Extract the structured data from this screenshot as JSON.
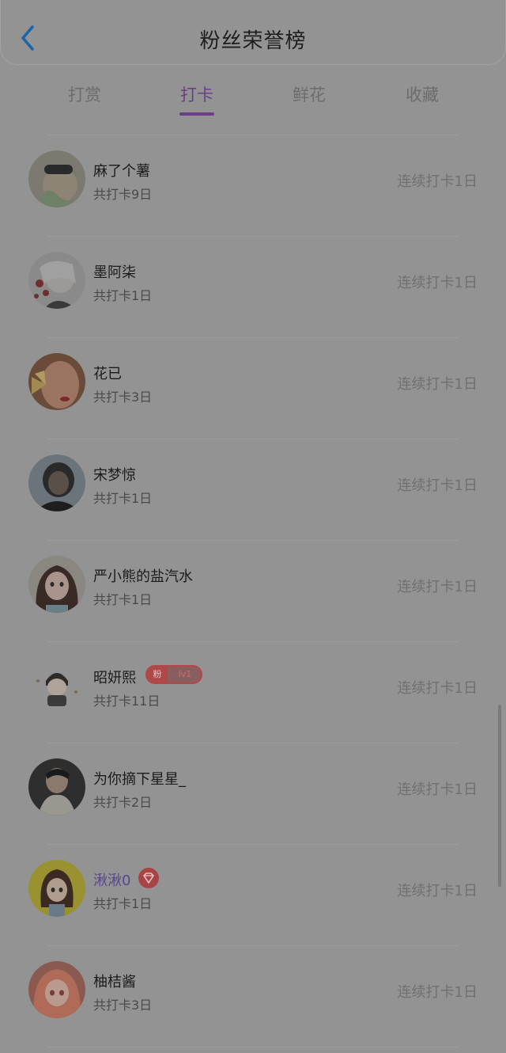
{
  "header": {
    "title": "粉丝荣誉榜",
    "back_icon": "chevron-left-icon",
    "back_color": "#1a66a8"
  },
  "tabs": [
    {
      "label": "打赏",
      "active": false
    },
    {
      "label": "打卡",
      "active": true
    },
    {
      "label": "鲜花",
      "active": false
    },
    {
      "label": "收藏",
      "active": false
    }
  ],
  "accent_color": "#6a3e86",
  "fans": [
    {
      "name": "麻了个薯",
      "total": "共打卡9日",
      "streak": "连续打卡1日",
      "avatar": "avatar-sunglasses-girl"
    },
    {
      "name": "墨阿柒",
      "total": "共打卡1日",
      "streak": "连续打卡1日",
      "avatar": "avatar-anime-girl-roses"
    },
    {
      "name": "花已",
      "total": "共打卡3日",
      "streak": "连续打卡1日",
      "avatar": "avatar-girl-butterfly"
    },
    {
      "name": "宋梦惊",
      "total": "共打卡1日",
      "streak": "连续打卡1日",
      "avatar": "avatar-dark-portrait"
    },
    {
      "name": "严小熊的盐汽水",
      "total": "共打卡1日",
      "streak": "连续打卡1日",
      "avatar": "avatar-illustrated-girl"
    },
    {
      "name": "昭妍熙",
      "total": "共打卡11日",
      "streak": "连续打卡1日",
      "avatar": "avatar-chibi-character",
      "badge": {
        "left": "粉",
        "right": "lv1"
      }
    },
    {
      "name": "为你摘下星星_",
      "total": "共打卡2日",
      "streak": "连续打卡1日",
      "avatar": "avatar-boy-hoodie"
    },
    {
      "name": "湫湫0",
      "total": "共打卡1日",
      "streak": "连续打卡1日",
      "avatar": "avatar-cartoon-girl-yellow",
      "vip": true
    },
    {
      "name": "柚桔酱",
      "total": "共打卡3日",
      "streak": "连续打卡1日",
      "avatar": "avatar-anime-orange-hair"
    }
  ]
}
